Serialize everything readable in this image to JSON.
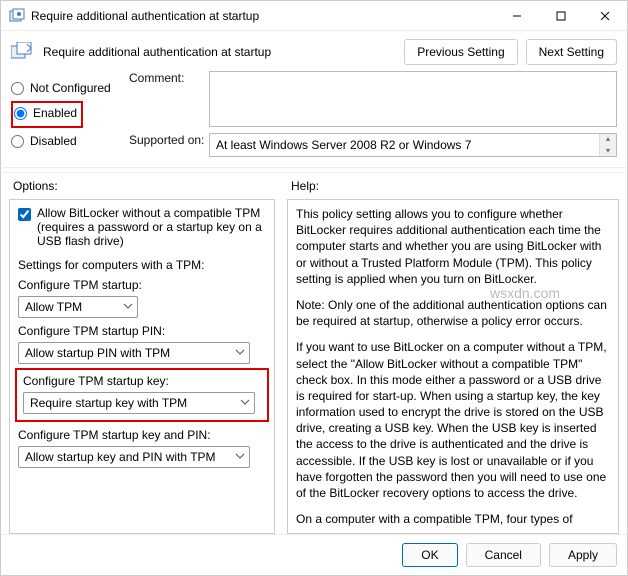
{
  "window": {
    "title": "Require additional authentication at startup"
  },
  "header": {
    "label": "Require additional authentication at startup",
    "prev": "Previous Setting",
    "next": "Next Setting"
  },
  "state": {
    "not_configured": "Not Configured",
    "enabled": "Enabled",
    "disabled": "Disabled"
  },
  "comment": {
    "label": "Comment:",
    "value": ""
  },
  "supported": {
    "label": "Supported on:",
    "value": "At least Windows Server 2008 R2 or Windows 7"
  },
  "panes": {
    "options_label": "Options:",
    "help_label": "Help:"
  },
  "options": {
    "allow_no_tpm": "Allow BitLocker without a compatible TPM (requires a password or a startup key on a USB flash drive)",
    "settings_hdr": "Settings for computers with a TPM:",
    "cfg_tpm_startup": "Configure TPM startup:",
    "cfg_tpm_startup_val": "Allow TPM",
    "cfg_tpm_pin": "Configure TPM startup PIN:",
    "cfg_tpm_pin_val": "Allow startup PIN with TPM",
    "cfg_tpm_key": "Configure TPM startup key:",
    "cfg_tpm_key_val": "Require startup key with TPM",
    "cfg_tpm_key_pin": "Configure TPM startup key and PIN:",
    "cfg_tpm_key_pin_val": "Allow startup key and PIN with TPM"
  },
  "help": {
    "p1": "This policy setting allows you to configure whether BitLocker requires additional authentication each time the computer starts and whether you are using BitLocker with or without a Trusted Platform Module (TPM). This policy setting is applied when you turn on BitLocker.",
    "p2": "Note: Only one of the additional authentication options can be required at startup, otherwise a policy error occurs.",
    "p3": "If you want to use BitLocker on a computer without a TPM, select the \"Allow BitLocker without a compatible TPM\" check box. In this mode either a password or a USB drive is required for start-up. When using a startup key, the key information used to encrypt the drive is stored on the USB drive, creating a USB key. When the USB key is inserted the access to the drive is authenticated and the drive is accessible. If the USB key is lost or unavailable or if you have forgotten the password then you will need to use one of the BitLocker recovery options to access the drive.",
    "p4": "On a computer with a compatible TPM, four types of"
  },
  "footer": {
    "ok": "OK",
    "cancel": "Cancel",
    "apply": "Apply"
  },
  "watermark": "wsxdn.com"
}
